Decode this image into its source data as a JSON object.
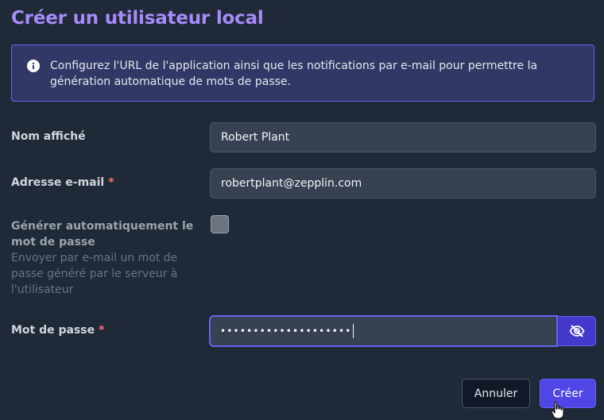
{
  "page": {
    "title": "Créer un utilisateur local"
  },
  "alert": {
    "icon": "info-icon",
    "text": "Configurez l'URL de l'application ainsi que les notifications par e-mail pour permettre la génération automatique de mots de passe."
  },
  "form": {
    "display_name": {
      "label": "Nom affiché",
      "value": "Robert Plant"
    },
    "email": {
      "label": "Adresse e-mail",
      "required_mark": "*",
      "value": "robertplant@zepplin.com"
    },
    "auto_password": {
      "label": "Générer automatiquement le mot de passe",
      "help": "Envoyer par e-mail un mot de passe généré par le serveur à l'utilisateur",
      "checked": false
    },
    "password": {
      "label": "Mot de passe",
      "required_mark": "*",
      "masked_value": "••••••••••••••••••••",
      "toggle_icon": "eye-slash-icon"
    }
  },
  "actions": {
    "cancel_label": "Annuler",
    "create_label": "Créer"
  },
  "colors": {
    "accent": "#6366f1",
    "title": "#a78bfa",
    "required": "#f87171",
    "background": "#1f2937"
  }
}
